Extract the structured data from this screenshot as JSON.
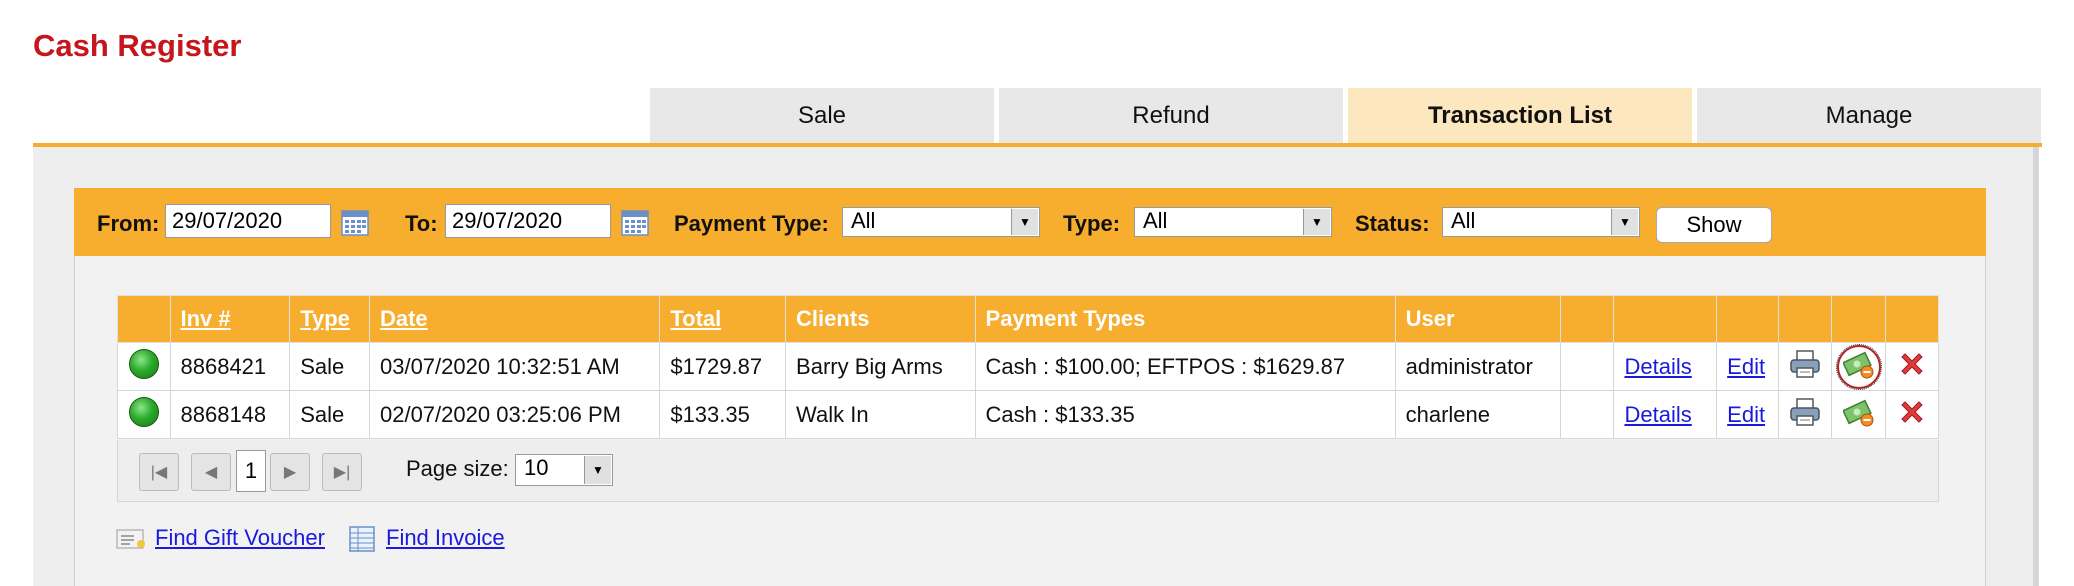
{
  "page": {
    "title": "Cash Register"
  },
  "tabs": [
    {
      "label": "Sale"
    },
    {
      "label": "Refund"
    },
    {
      "label": "Transaction List"
    },
    {
      "label": "Manage"
    }
  ],
  "filters": {
    "from_label": "From:",
    "from_value": "29/07/2020",
    "to_label": "To:",
    "to_value": "29/07/2020",
    "payment_type_label": "Payment Type:",
    "payment_type_value": "All",
    "type_label": "Type:",
    "type_value": "All",
    "status_label": "Status:",
    "status_value": "All",
    "show_label": "Show"
  },
  "table": {
    "headers": [
      "",
      "Inv #",
      "Type",
      "Date",
      "Total",
      "Clients",
      "Payment Types",
      "User"
    ],
    "rows": [
      {
        "inv": "8868421",
        "type": "Sale",
        "date": "03/07/2020 10:32:51 AM",
        "total": "$1729.87",
        "client": "Barry Big Arms",
        "payment": "Cash : $100.00; EFTPOS : $1629.87",
        "user": "administrator",
        "details": "Details",
        "edit": "Edit"
      },
      {
        "inv": "8868148",
        "type": "Sale",
        "date": "02/07/2020 03:25:06 PM",
        "total": "$133.35",
        "client": "Walk In",
        "payment": "Cash : $133.35",
        "user": "charlene",
        "details": "Details",
        "edit": "Edit"
      }
    ]
  },
  "pager": {
    "current_page": "1",
    "page_size_label": "Page size:",
    "page_size_value": "10"
  },
  "links": {
    "find_gift_voucher": "Find Gift Voucher",
    "find_invoice": "Find Invoice"
  },
  "colors": {
    "brand_red": "#c4161c",
    "accent_orange": "#f7ad2e",
    "active_tab": "#fde7bf",
    "link_blue": "#1a1adb"
  },
  "icons": [
    "calendar-icon",
    "dropdown-arrow-icon",
    "status-green-icon",
    "print-icon",
    "money-refund-icon",
    "delete-icon",
    "first-page-icon",
    "prev-page-icon",
    "next-page-icon",
    "last-page-icon",
    "gift-voucher-icon",
    "invoice-icon"
  ]
}
